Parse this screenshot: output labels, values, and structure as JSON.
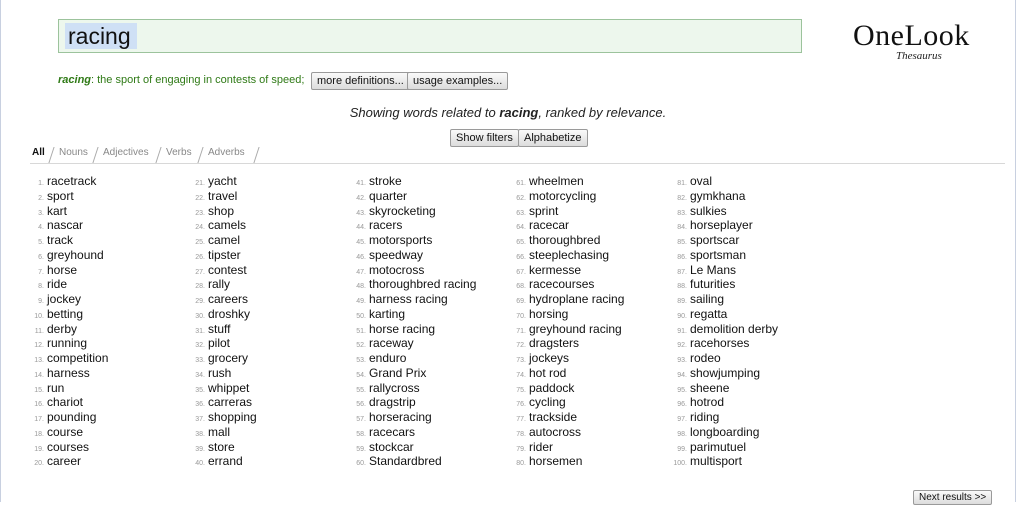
{
  "search": {
    "value": "racing"
  },
  "logo": {
    "title": "OneLook",
    "subtitle": "Thesaurus"
  },
  "definition": {
    "word": "racing",
    "text": ": the sport of engaging in contests of speed;",
    "more_label": "more definitions...",
    "usage_label": "usage examples..."
  },
  "summary": {
    "prefix": "Showing words related to ",
    "word": "racing",
    "suffix": ", ranked by relevance."
  },
  "controls": {
    "filters_label": "Show filters",
    "alphabetize_label": "Alphabetize"
  },
  "tabs": [
    "All",
    "Nouns",
    "Adjectives",
    "Verbs",
    "Adverbs"
  ],
  "results": [
    "racetrack",
    "sport",
    "kart",
    "nascar",
    "track",
    "greyhound",
    "horse",
    "ride",
    "jockey",
    "betting",
    "derby",
    "running",
    "competition",
    "harness",
    "run",
    "chariot",
    "pounding",
    "course",
    "courses",
    "career",
    "yacht",
    "travel",
    "shop",
    "camels",
    "camel",
    "tipster",
    "contest",
    "rally",
    "careers",
    "droshky",
    "stuff",
    "pilot",
    "grocery",
    "rush",
    "whippet",
    "carreras",
    "shopping",
    "mall",
    "store",
    "errand",
    "stroke",
    "quarter",
    "skyrocketing",
    "racers",
    "motorsports",
    "speedway",
    "motocross",
    "thoroughbred racing",
    "harness racing",
    "karting",
    "horse racing",
    "raceway",
    "enduro",
    "Grand Prix",
    "rallycross",
    "dragstrip",
    "horseracing",
    "racecars",
    "stockcar",
    "Standardbred",
    "wheelmen",
    "motorcycling",
    "sprint",
    "racecar",
    "thoroughbred",
    "steeplechasing",
    "kermesse",
    "racecourses",
    "hydroplane racing",
    "horsing",
    "greyhound racing",
    "dragsters",
    "jockeys",
    "hot rod",
    "paddock",
    "cycling",
    "trackside",
    "autocross",
    "rider",
    "horsemen",
    "oval",
    "gymkhana",
    "sulkies",
    "horseplayer",
    "sportscar",
    "sportsman",
    "Le Mans",
    "futurities",
    "sailing",
    "regatta",
    "demolition derby",
    "racehorses",
    "rodeo",
    "showjumping",
    "sheene",
    "hotrod",
    "riding",
    "longboarding",
    "parimutuel",
    "multisport"
  ],
  "pagination": {
    "next_label": "Next results >>"
  }
}
